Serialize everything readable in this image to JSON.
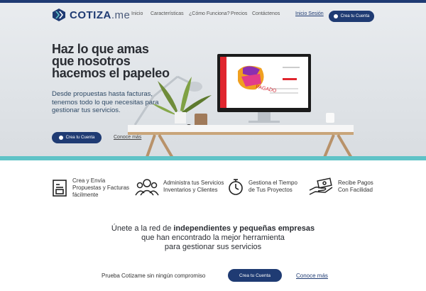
{
  "brand": {
    "name": "COTIZA",
    "suffix": ".me",
    "color": "#1f3b73",
    "accent": "#5fc3c7"
  },
  "nav": {
    "links": [
      "Inicio",
      "Características",
      "¿Cómo Funciona?",
      "Precios",
      "Contáctenos"
    ],
    "login": "Inicio Sesión",
    "signup": "Crea tu Cuenta"
  },
  "hero": {
    "title": "Haz lo que amas que nosotros hacemos el papeleo",
    "subtitle": "Desde propuestas hasta facturas, tenemos todo lo que necesitas para gestionar tus servicios.",
    "signup": "Crea tu Cuenta",
    "learn_more": "Conoce más",
    "stamp": "PAGADO"
  },
  "features": [
    {
      "icon": "invoice-icon",
      "text": "Crea y Envía Propuestas y Facturas fácilmente"
    },
    {
      "icon": "people-icon",
      "text": "Administra tus Servicios Inventarios y Clientes"
    },
    {
      "icon": "stopwatch-icon",
      "text": "Gestiona el Tiempo de Tus Proyectos"
    },
    {
      "icon": "payment-icon",
      "text": "Recibe Pagos Con Facilidad"
    }
  ],
  "join": {
    "pre": "Únete a la red de ",
    "bold": "independientes y pequeñas empresas",
    "line2": "que han encontrado la mejor herramienta",
    "line3": "para gestionar sus servicios"
  },
  "cta": {
    "text": "Prueba Cotizame sin ningún compromiso",
    "button": "Crea tu Cuenta",
    "link": "Conoce más"
  }
}
